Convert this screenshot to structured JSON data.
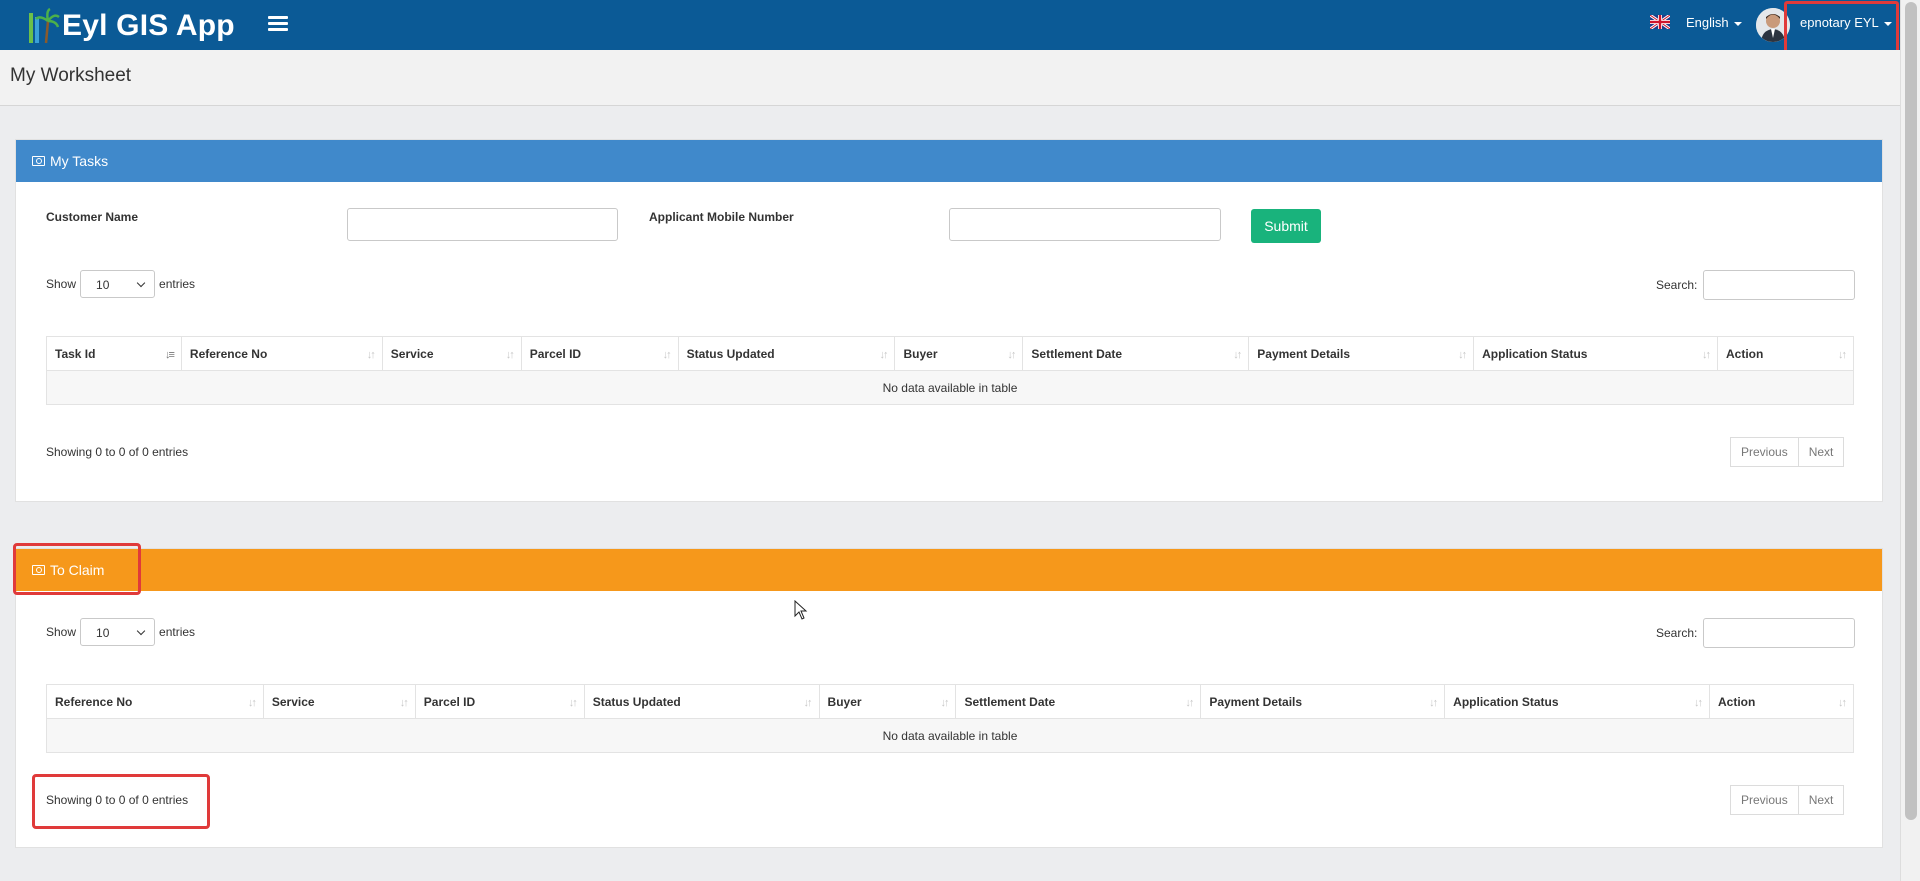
{
  "app": {
    "logo_text": "Eyl GIS App",
    "language": "English",
    "user": "epnotary EYL"
  },
  "page": {
    "title": "My Worksheet"
  },
  "my_tasks": {
    "title": "My Tasks",
    "customer_name_label": "Customer Name",
    "mobile_label": "Applicant Mobile Number",
    "customer_name_value": "",
    "mobile_value": "",
    "submit_label": "Submit",
    "show_label": "Show",
    "entries_label": "entries",
    "page_length": "10",
    "search_label": "Search:",
    "columns": [
      "Task Id",
      "Reference No",
      "Service",
      "Parcel ID",
      "Status Updated",
      "Buyer",
      "Settlement Date",
      "Payment Details",
      "Application Status",
      "Action"
    ],
    "empty_text": "No data available in table",
    "info": "Showing 0 to 0 of 0 entries",
    "prev_label": "Previous",
    "next_label": "Next"
  },
  "to_claim": {
    "title": "To Claim",
    "show_label": "Show",
    "entries_label": "entries",
    "page_length": "10",
    "search_label": "Search:",
    "columns": [
      "Reference No",
      "Service",
      "Parcel ID",
      "Status Updated",
      "Buyer",
      "Settlement Date",
      "Payment Details",
      "Application Status",
      "Action"
    ],
    "empty_text": "No data available in table",
    "info": "Showing 0 to 0 of 0 entries",
    "prev_label": "Previous",
    "next_label": "Next"
  },
  "colors": {
    "topbar": "#0b5a96",
    "my_tasks_header": "#4089cb",
    "to_claim_header": "#f6981b",
    "submit": "#19b37c",
    "highlight": "#e03a3a"
  },
  "icons": [
    "menu-icon",
    "uk-flag-icon",
    "user-avatar-icon",
    "panel-camera-icon",
    "sort-icon",
    "mouse-cursor-icon"
  ]
}
